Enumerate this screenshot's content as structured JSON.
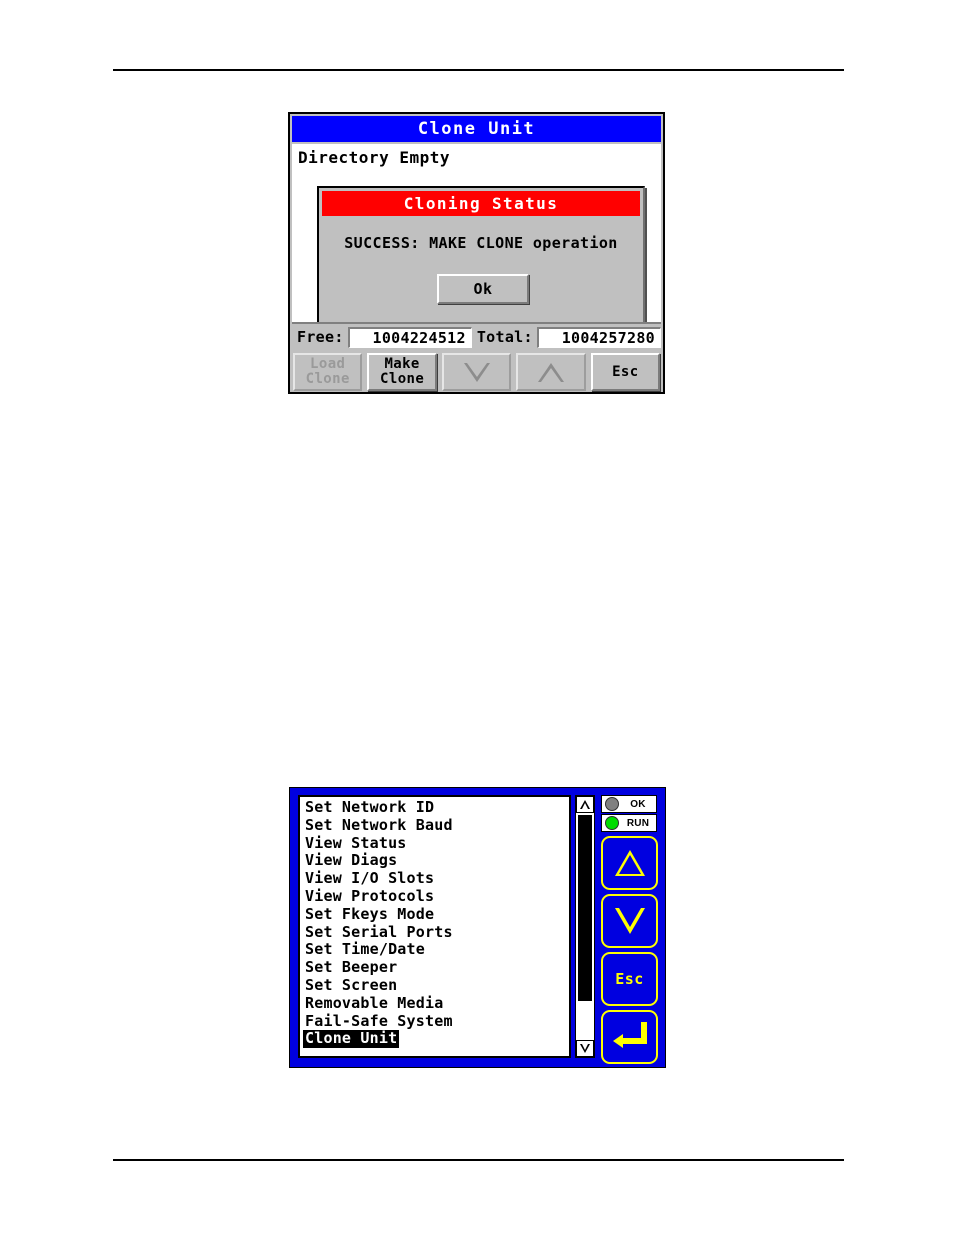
{
  "colors": {
    "title_blue": "#0000ff",
    "dialog_red": "#ff0000",
    "face_gray": "#c0c0c0",
    "keypad_blue": "#0000e0",
    "keypad_yellow": "#ffff00",
    "led_on_green": "#00dd00",
    "led_off_gray": "#808080",
    "link_blue": "#0000c0"
  },
  "document": {
    "link_text": ""
  },
  "clone_unit_panel": {
    "title": "Clone Unit",
    "directory_text": "Directory Empty",
    "dialog": {
      "title": "Cloning Status",
      "message": "SUCCESS: MAKE CLONE operation",
      "ok_label": "Ok"
    },
    "status": {
      "free_label": "Free:",
      "free_value": "1004224512",
      "total_label": "Total:",
      "total_value": "1004257280"
    },
    "buttons": [
      {
        "name": "load-clone",
        "line1": "Load",
        "line2": "Clone",
        "enabled": false,
        "icon": ""
      },
      {
        "name": "make-clone",
        "line1": "Make",
        "line2": "Clone",
        "enabled": true,
        "icon": ""
      },
      {
        "name": "scroll-down",
        "line1": "",
        "line2": "",
        "enabled": false,
        "icon": "triangle-down-icon"
      },
      {
        "name": "scroll-up",
        "line1": "",
        "line2": "",
        "enabled": false,
        "icon": "triangle-up-icon"
      },
      {
        "name": "esc",
        "line1": "Esc",
        "line2": "",
        "enabled": true,
        "icon": ""
      }
    ]
  },
  "device_menu": {
    "items": [
      {
        "label": "Set Network ID",
        "selected": false
      },
      {
        "label": "Set Network Baud",
        "selected": false
      },
      {
        "label": "View Status",
        "selected": false
      },
      {
        "label": "View Diags",
        "selected": false
      },
      {
        "label": "View I/O Slots",
        "selected": false
      },
      {
        "label": "View Protocols",
        "selected": false
      },
      {
        "label": "Set Fkeys Mode",
        "selected": false
      },
      {
        "label": "Set Serial Ports",
        "selected": false
      },
      {
        "label": "Set Time/Date",
        "selected": false
      },
      {
        "label": "Set Beeper",
        "selected": false
      },
      {
        "label": "Set Screen",
        "selected": false
      },
      {
        "label": "Removable Media",
        "selected": false
      },
      {
        "label": "Fail-Safe System",
        "selected": false
      },
      {
        "label": "Clone Unit",
        "selected": true
      }
    ],
    "leds": [
      {
        "label": "OK",
        "state": "off",
        "color": "#808080"
      },
      {
        "label": "RUN",
        "state": "on",
        "color": "#00dd00"
      }
    ],
    "keys": [
      {
        "name": "up",
        "label": "",
        "icon": "triangle-up-icon"
      },
      {
        "name": "down",
        "label": "",
        "icon": "triangle-down-icon"
      },
      {
        "name": "esc",
        "label": "Esc",
        "icon": ""
      },
      {
        "name": "enter",
        "label": "",
        "icon": "enter-arrow-icon"
      }
    ]
  }
}
